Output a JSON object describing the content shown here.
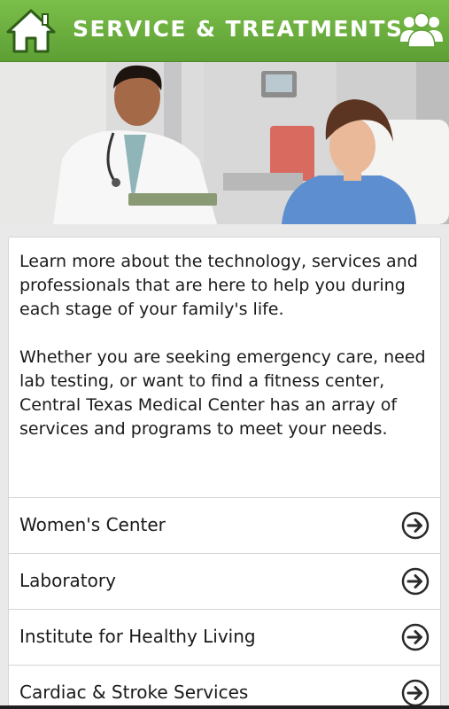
{
  "header": {
    "title": "SERVICE & TREATMENTS",
    "home_icon": "home-icon",
    "people_icon": "people-icon"
  },
  "hero": {
    "description_icon": "doctor-patient-photo"
  },
  "intro": {
    "paragraph1": "Learn more about the technology, services and professionals that are here to help you during each stage of your family's life.",
    "paragraph2": "Whether you are seeking emergency care, need lab testing, or want to find a fitness center, Central Texas Medical Center has an array of services and programs to meet your needs."
  },
  "menu": {
    "items": [
      {
        "label": "Women's Center"
      },
      {
        "label": "Laboratory"
      },
      {
        "label": "Institute for Healthy Living"
      },
      {
        "label": "Cardiac & Stroke Services"
      }
    ]
  },
  "colors": {
    "header_green": "#6aae3d",
    "background": "#e9e9ea",
    "text": "#1a1a1a"
  }
}
